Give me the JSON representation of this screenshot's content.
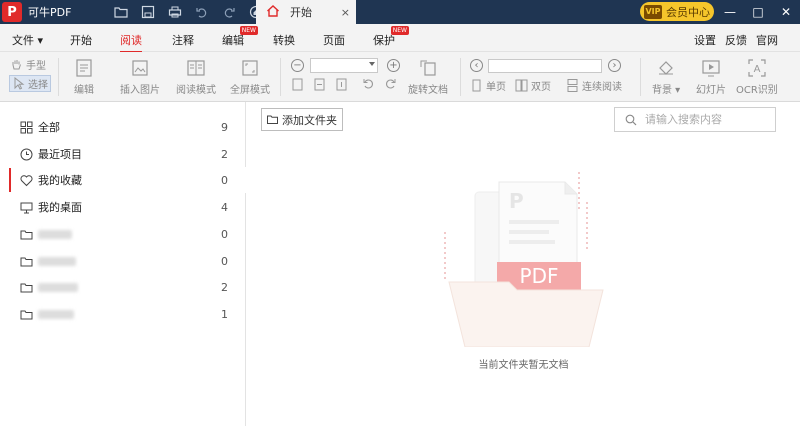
{
  "app": {
    "logo_letter": "P",
    "title": "可牛PDF"
  },
  "tab": {
    "label": "开始",
    "close": "×"
  },
  "vip": {
    "crown": "VIP",
    "label": "会员中心"
  },
  "window": {
    "minimize": "—",
    "maximize": "□",
    "close": "✕"
  },
  "menu": {
    "file": "文件",
    "items": [
      "开始",
      "阅读",
      "注释",
      "编辑",
      "转换",
      "页面",
      "保护"
    ],
    "new_badge": "NEW",
    "active": "阅读",
    "right": [
      "设置",
      "反馈",
      "官网"
    ]
  },
  "toolbar": {
    "hand": "手型",
    "select": "选择",
    "edit": "编辑",
    "insert_image": "插入图片",
    "read_mode": "阅读模式",
    "fullscreen": "全屏模式",
    "zoom_value": "",
    "rotate_doc": "旋转文档",
    "single_page": "单页",
    "double_page": "双页",
    "continuous": "连续阅读",
    "background": "背景",
    "slideshow": "幻灯片",
    "ocr": "OCR识别",
    "ocr_icon_text": "A"
  },
  "sidebar": {
    "items": [
      {
        "label": "全部",
        "count": "9",
        "icon": "grid-icon"
      },
      {
        "label": "最近项目",
        "count": "2",
        "icon": "clock-icon"
      },
      {
        "label": "我的收藏",
        "count": "0",
        "icon": "heart-icon"
      },
      {
        "label": "我的桌面",
        "count": "4",
        "icon": "desktop-icon"
      }
    ],
    "folders": [
      {
        "count": "0"
      },
      {
        "count": "0"
      },
      {
        "count": "2"
      },
      {
        "count": "1"
      }
    ]
  },
  "main": {
    "add_folder": "添加文件夹",
    "search_placeholder": "请输入搜索内容",
    "empty_text": "当前文件夹暂无文档",
    "art_pdf_label": "PDF",
    "art_logo_letter": "P"
  },
  "colors": {
    "titlebar": "#1f3552",
    "accent": "#e02a2a",
    "vip": "#f5c52b"
  }
}
